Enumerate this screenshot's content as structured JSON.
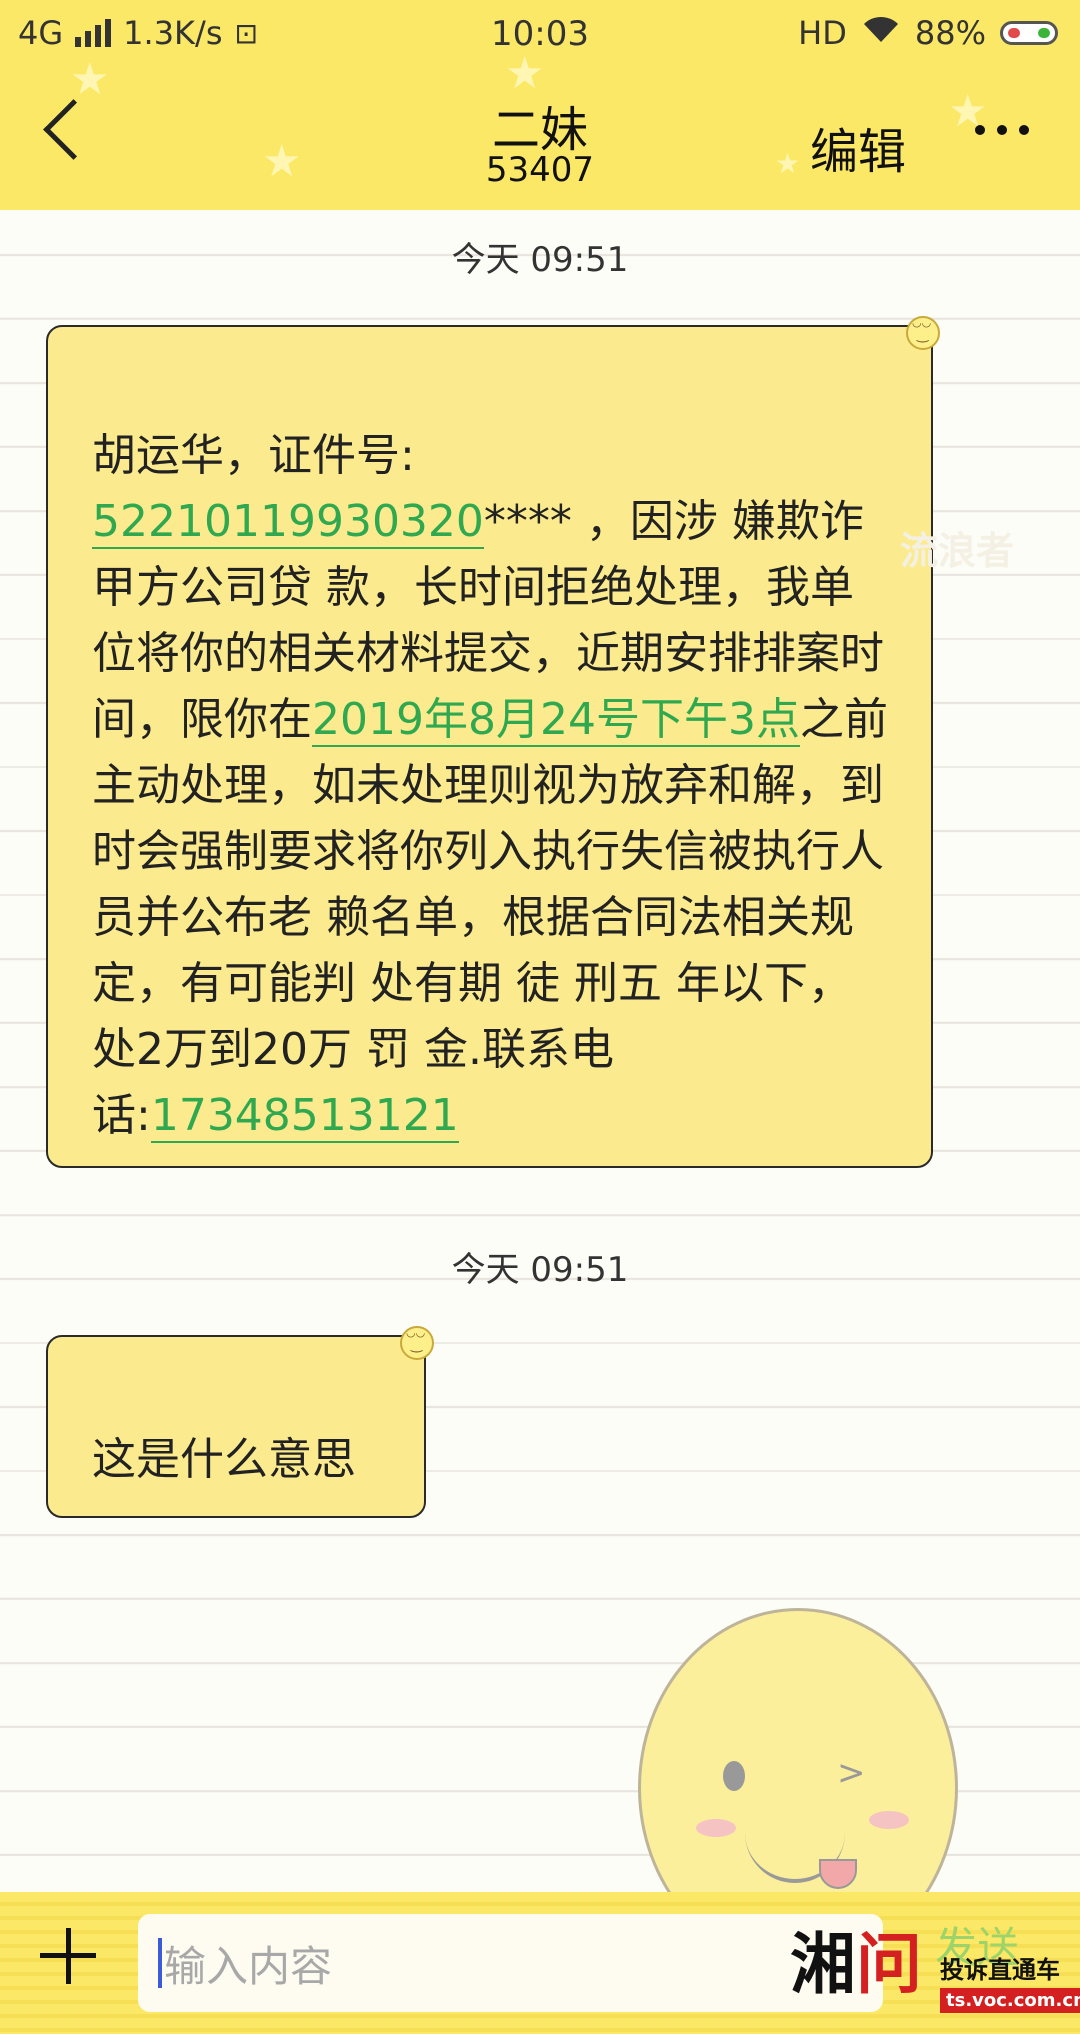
{
  "status_bar": {
    "network": "4G",
    "speed": "1.3K/s",
    "time": "10:03",
    "hd": "HD",
    "battery_percent": "88%"
  },
  "header": {
    "contact_name": "二妹",
    "contact_number": "53407",
    "edit_label": "编辑"
  },
  "messages": [
    {
      "timestamp": "今天 09:51",
      "segments": [
        {
          "text": "胡运华，证件号:",
          "link": false
        },
        {
          "text": "52210119930320",
          "link": true
        },
        {
          "text": "**** ，因涉 嫌欺诈甲方公司贷 款，长时间拒绝处理，我单位将你的相关材料提交，近期安排排案时间，限你在",
          "link": false
        },
        {
          "text": "2019年8月24号下午3点",
          "link": true
        },
        {
          "text": "之前主动处理，如未处理则视为放弃和解，到时会强制要求将你列入执行失信被执行人员并公布老 赖名单，根据合同法相关规定，有可能判 处有期 徒 刑五 年以下，处2万到20万 罚 金.联系电话:",
          "link": false
        },
        {
          "text": "17348513121",
          "link": true
        }
      ]
    },
    {
      "timestamp": "今天 09:51",
      "text": "这是什么意思"
    }
  ],
  "watermark": "流浪者",
  "input": {
    "placeholder": "输入内容",
    "send_label": "发送"
  },
  "brand": {
    "logo_left": "湘",
    "logo_right": "问",
    "tagline": "投诉直通车",
    "url": "ts.voc.com.cn"
  },
  "colors": {
    "header_bg": "#fbe866",
    "bubble_bg": "#fbeb8e",
    "link": "#2fa84f"
  }
}
